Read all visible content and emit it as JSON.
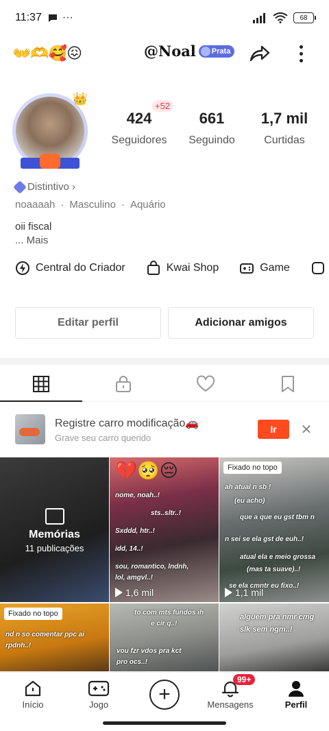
{
  "status_bar": {
    "time": "11:37",
    "dots": "···",
    "battery": "68"
  },
  "header": {
    "emojis": "👐🫶🥰😖",
    "username": "@Noal",
    "badge": "Prata"
  },
  "stats": [
    {
      "value": "424",
      "label": "Seguidores",
      "badge": "+52"
    },
    {
      "value": "661",
      "label": "Seguindo"
    },
    {
      "value": "1,7 mil",
      "label": "Curtidas"
    }
  ],
  "profile": {
    "distintivo": "Distintivo ›",
    "handle": "noaaaah",
    "sep": "·",
    "gender": "Masculino",
    "sign": "Aquário",
    "bio": "oii fiscal",
    "more": "... Mais"
  },
  "quick_links": [
    {
      "label": "Central do Criador",
      "icon": "creator-center-icon"
    },
    {
      "label": "Kwai Shop",
      "icon": "shopping-bag-icon"
    },
    {
      "label": "Game",
      "icon": "gamepad-icon"
    }
  ],
  "buttons": {
    "edit": "Editar perfil",
    "add_friends": "Adicionar amigos"
  },
  "tabs": [
    "grid-icon",
    "lock-icon",
    "heart-icon",
    "bookmark-icon"
  ],
  "promo": {
    "title": "Registre carro modificação🚗",
    "subtitle": "Grave seu carro querido",
    "go": "Ir",
    "close": "✕"
  },
  "grid": {
    "memorias": {
      "title": "Memórias",
      "count": "11 publicações"
    },
    "cell2": {
      "emojis": "💔🥺😔",
      "views": "1,6 mil",
      "lines": [
        "nome, noah..!",
        "sts..sltr..!",
        "Sxddd, htr..!",
        "idd, 14..!",
        "sou, romantico, lndnh,",
        "lol, amgvl..!"
      ]
    },
    "cell3": {
      "pin": "Fixado no topo",
      "views": "1,1 mil",
      "lines": [
        "ah atual n sb !",
        "(eu acho)",
        "que a que eu gst tbm n",
        "n sei se ela gst de euh..!",
        "atual ela e meio grossa",
        "(mas ta suave)..!",
        "se ela cmntr eu fixo..!"
      ]
    },
    "cell4": {
      "pin": "Fixado no topo",
      "lines": [
        "nd n so comentar ppc ai",
        "rpdnh..!"
      ]
    },
    "cell5": {
      "lines": [
        "to com mts fundos ih",
        "e cir q..!",
        "vou fzr vdos pra kct",
        "pro ocs..!"
      ]
    },
    "cell6": {
      "lines": [
        "alguem pra nmr cmg",
        "slk sem ngm..!"
      ]
    }
  },
  "nav": [
    {
      "label": "Início",
      "icon": "home-icon"
    },
    {
      "label": "Jogo",
      "icon": "gamepad-icon"
    },
    {
      "label": "",
      "icon": "create-plus-icon"
    },
    {
      "label": "Mensagens",
      "icon": "bell-icon",
      "badge": "99+"
    },
    {
      "label": "Perfil",
      "icon": "person-icon"
    }
  ],
  "colors": {
    "accent": "#ff4b1f",
    "badge_red": "#e8233b",
    "prata": "#5b6de0"
  }
}
